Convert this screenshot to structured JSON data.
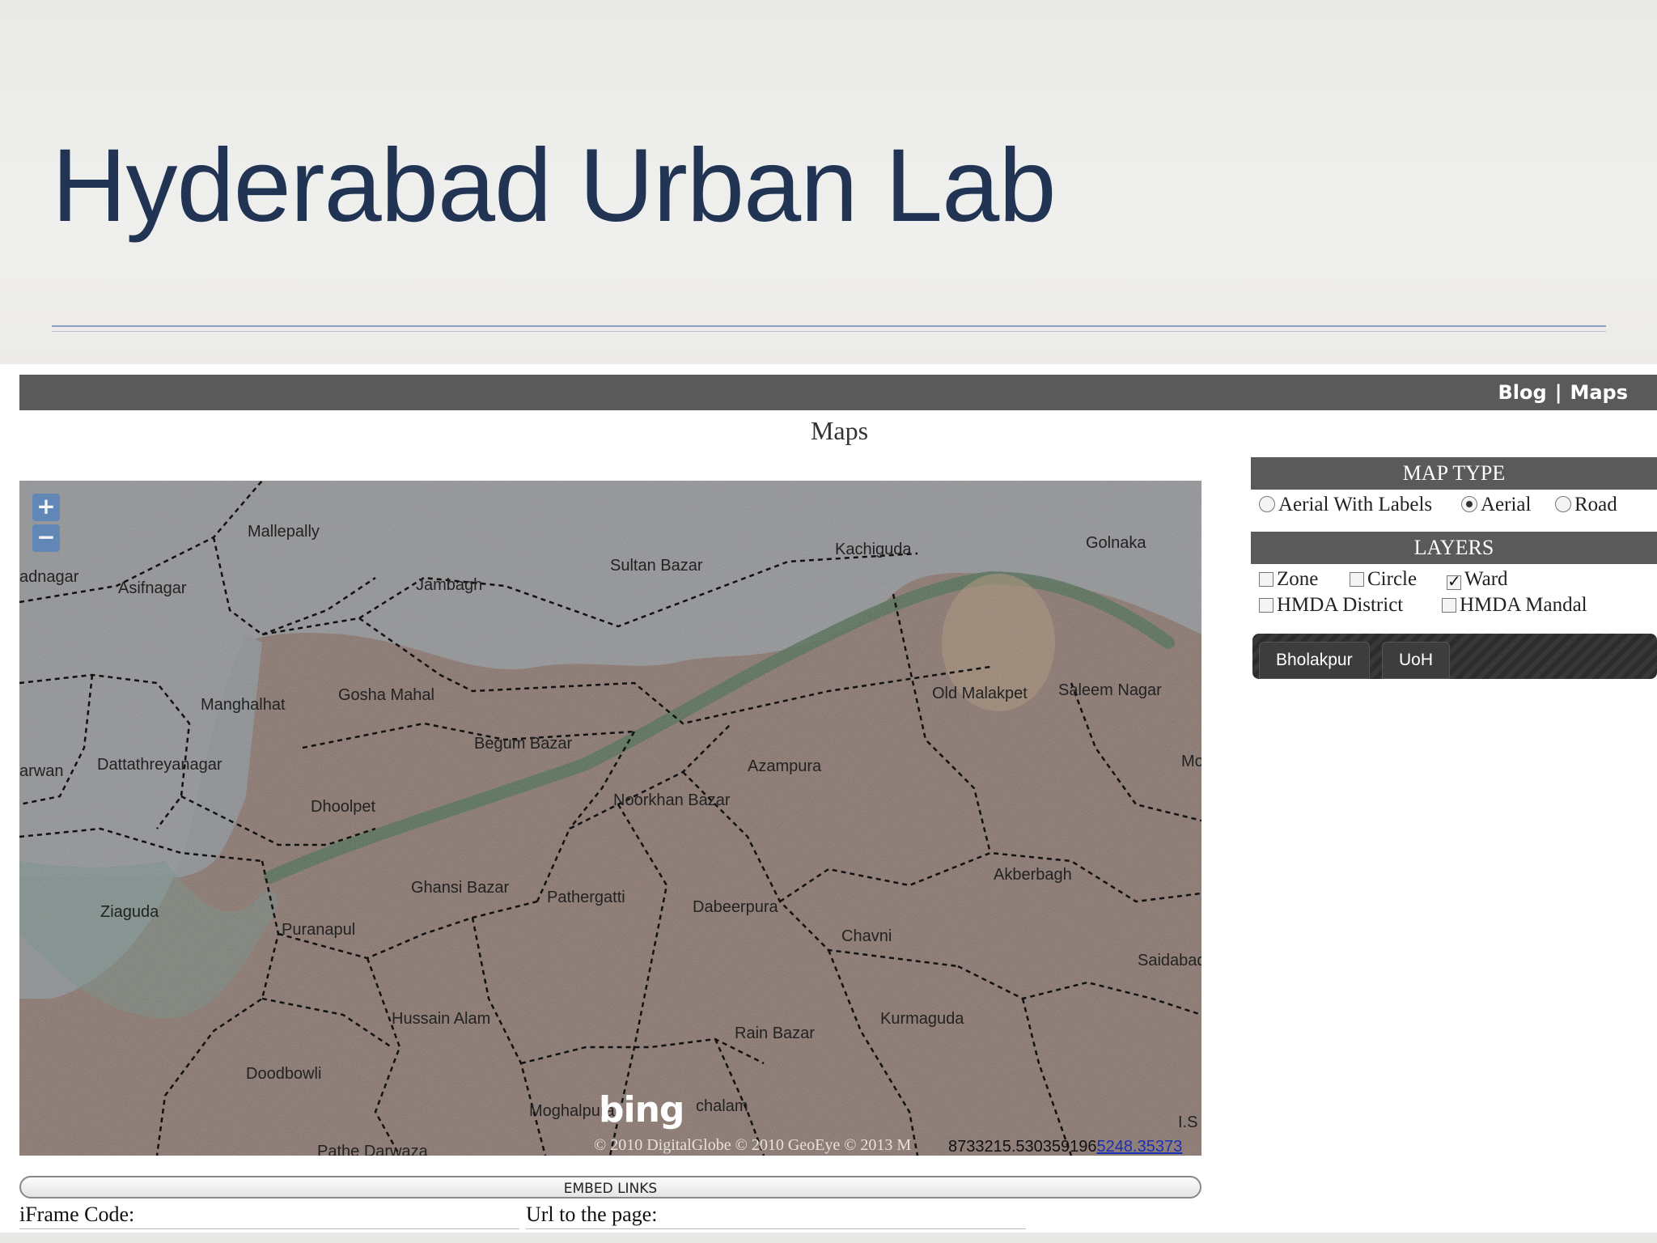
{
  "slide": {
    "title": "Hyderabad Urban Lab"
  },
  "nav": {
    "blog": "Blog",
    "separator": "|",
    "maps": "Maps"
  },
  "page": {
    "heading": "Maps"
  },
  "map": {
    "zoom_in": "+",
    "zoom_out": "−",
    "places": [
      "Mallepally",
      "adnagar",
      "Asifnagar",
      "Jambagh",
      "Sultan Bazar",
      "Kachiguda",
      "Golnaka",
      "Manghalhat",
      "Gosha Mahal",
      "Old Malakpet",
      "Saleem Nagar",
      "Begum Bazar",
      "Azampura",
      "arwan",
      "Dattathreyanagar",
      "Noorkhan Bazar",
      "Mo",
      "Dhoolpet",
      "Akberbagh",
      "Ghansi Bazar",
      "Pathergatti",
      "Dabeerpura",
      "Ziaguda",
      "Puranapul",
      "Chavni",
      "Saidabad",
      "Hussain Alam",
      "Kurmaguda",
      "Rain Bazar",
      "Doodbowli",
      "Moghalpura",
      "chalam",
      "I.S",
      "Pathe Darwaza"
    ],
    "logo": "bing",
    "copyright": "© 2010 DigitalGlobe © 2010 GeoEye © 2013 M",
    "coords": "8733215.530359196",
    "coords_link": "5248.35373"
  },
  "map_type": {
    "title": "MAP TYPE",
    "options": [
      {
        "label": "Aerial With Labels",
        "selected": false
      },
      {
        "label": "Aerial",
        "selected": true
      },
      {
        "label": "Road",
        "selected": false
      }
    ]
  },
  "layers": {
    "title": "LAYERS",
    "options": [
      {
        "label": "Zone",
        "checked": false
      },
      {
        "label": "Circle",
        "checked": false
      },
      {
        "label": "Ward",
        "checked": true
      },
      {
        "label": "HMDA District",
        "checked": false
      },
      {
        "label": "HMDA Mandal",
        "checked": false
      }
    ]
  },
  "tabs": [
    "Bholakpur",
    "UoH"
  ],
  "embed": {
    "bar_label": "EMBED LINKS",
    "iframe_label": "iFrame Code:",
    "url_label": "Url to the page:"
  },
  "colors": {
    "title": "#213454",
    "bar": "#5a5a5a",
    "river": "#4f6a52",
    "water_edge": "#5f8c7c"
  }
}
